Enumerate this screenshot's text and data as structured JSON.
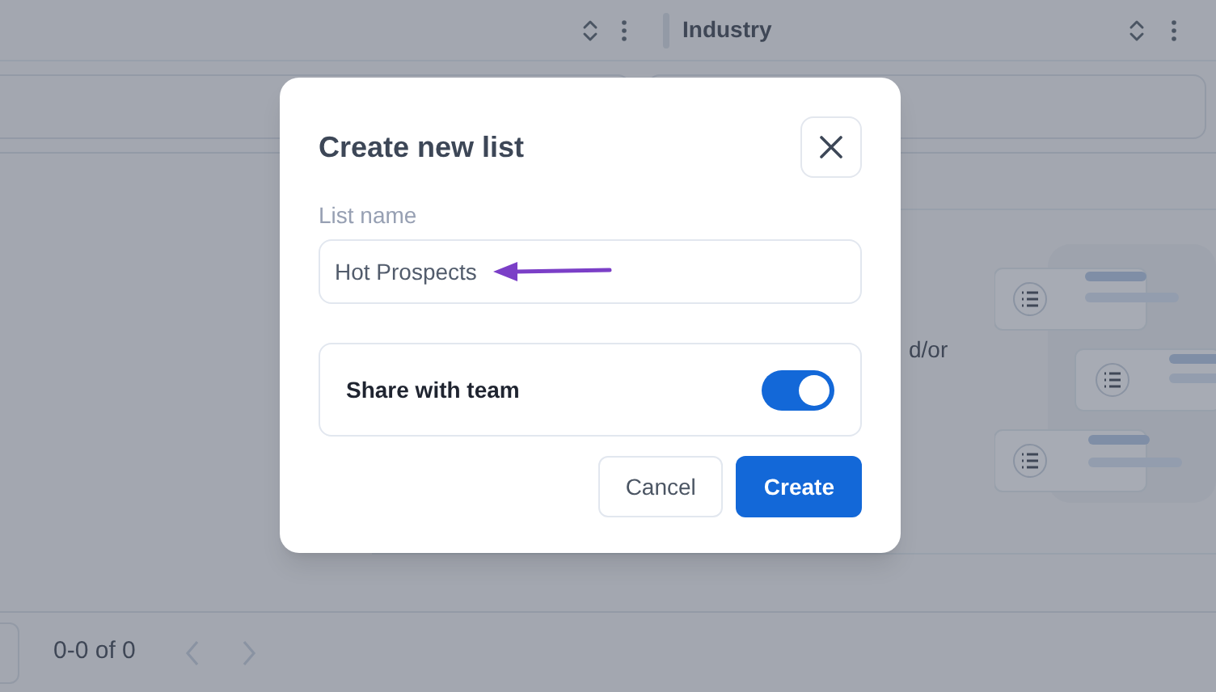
{
  "table": {
    "columns": [
      {
        "heading": "Industry"
      }
    ],
    "empty_state": {
      "text": "d/or"
    }
  },
  "pagination": {
    "range": "0-0 of 0"
  },
  "dialog": {
    "title": "Create new list",
    "field": {
      "label": "List name",
      "value": "Hot Prospects"
    },
    "share": {
      "label": "Share with team",
      "on": true
    },
    "buttons": [
      {
        "label": "Cancel",
        "kind": "secondary"
      },
      {
        "label": "Create",
        "kind": "primary"
      }
    ]
  }
}
